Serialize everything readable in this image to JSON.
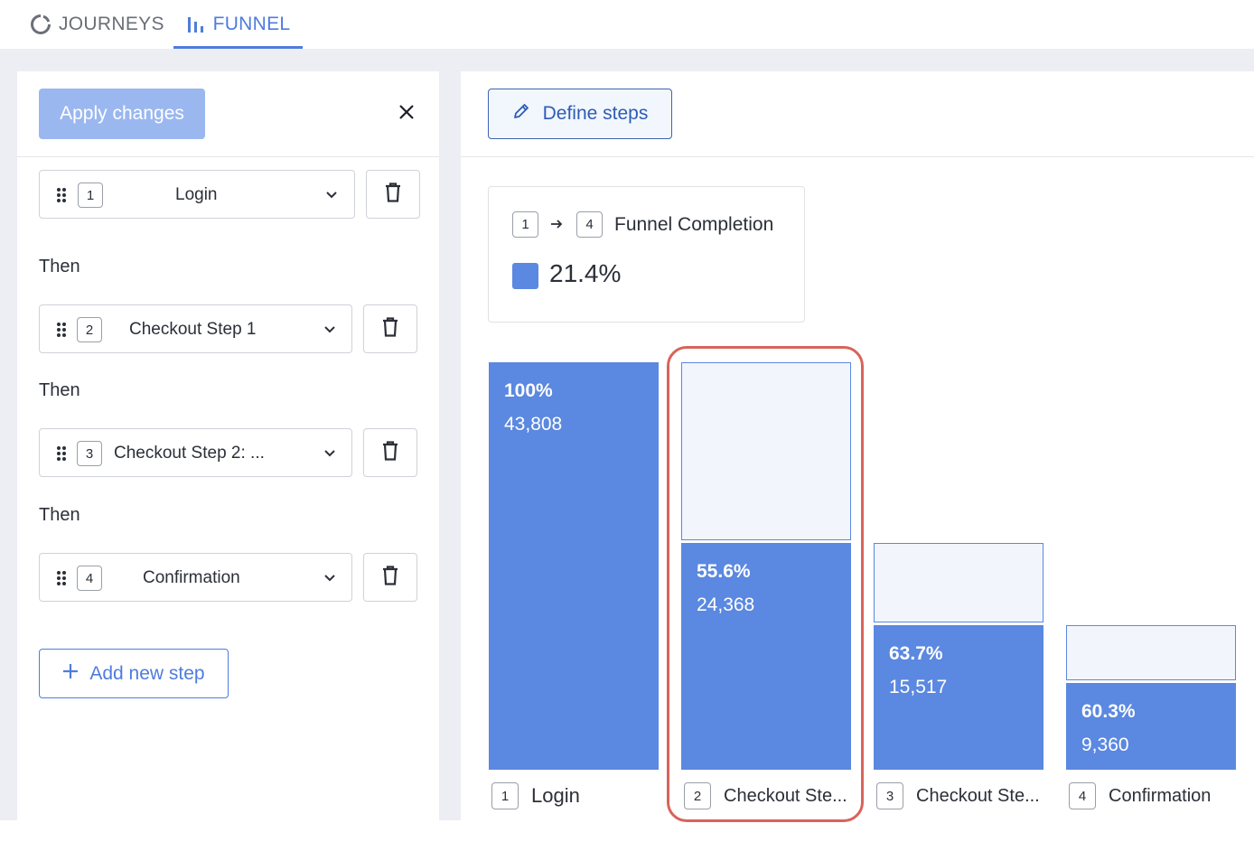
{
  "tabs": [
    {
      "label": "JOURNEYS",
      "icon": "circle-arc-icon",
      "active": false
    },
    {
      "label": "FUNNEL",
      "icon": "bar-chart-icon",
      "active": true
    }
  ],
  "left_panel": {
    "apply_label": "Apply changes",
    "then_label": "Then",
    "steps": [
      {
        "number": "1",
        "label": "Login"
      },
      {
        "number": "2",
        "label": "Checkout Step 1"
      },
      {
        "number": "3",
        "label": "Checkout Step 2: ..."
      },
      {
        "number": "4",
        "label": "Confirmation"
      }
    ],
    "add_label": "Add new step"
  },
  "right_panel": {
    "define_label": "Define steps",
    "summary": {
      "from": "1",
      "to": "4",
      "title": "Funnel Completion",
      "value": "21.4%",
      "swatch_color": "#5b88e0"
    }
  },
  "chart_data": {
    "type": "bar",
    "categories": [
      "Login",
      "Checkout Ste...",
      "Checkout Ste...",
      "Confirmation"
    ],
    "category_numbers": [
      "1",
      "2",
      "3",
      "4"
    ],
    "counts": [
      43808,
      24368,
      15517,
      9360
    ],
    "count_labels": [
      "43,808",
      "24,368",
      "15,517",
      "9,360"
    ],
    "step_conversion_labels": [
      "100%",
      "55.6%",
      "63.7%",
      "60.3%"
    ],
    "bar_color": "#5b88e0",
    "empty_color": "#f2f5fc",
    "highlighted_index": 1
  }
}
